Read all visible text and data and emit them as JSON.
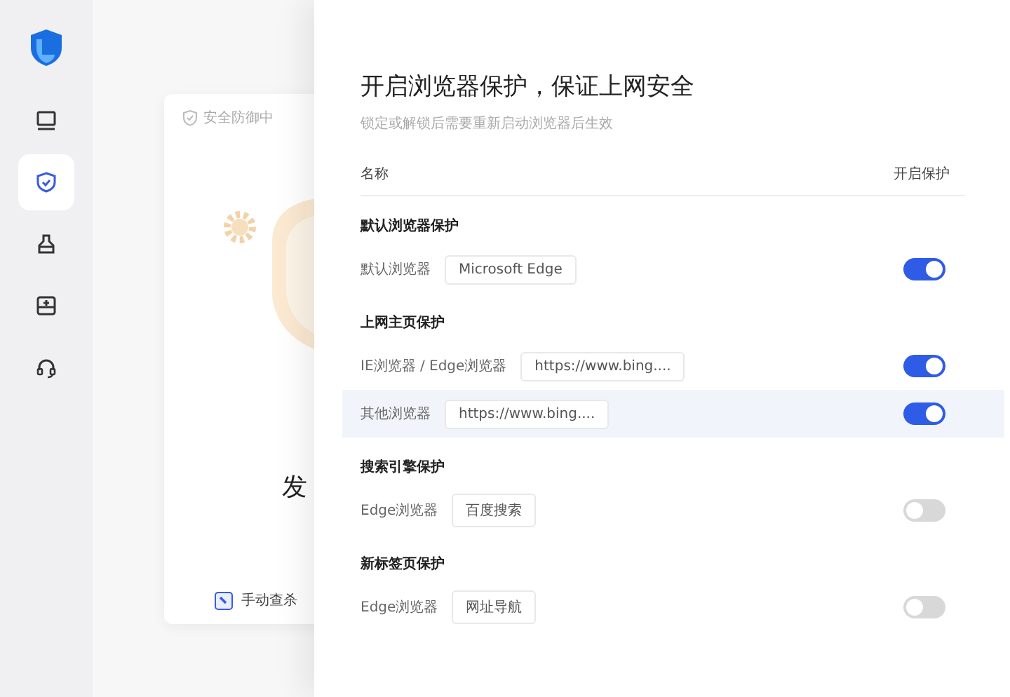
{
  "sidebar": {
    "items": [
      {
        "kind": "monitor",
        "selected": false
      },
      {
        "kind": "shield",
        "selected": true
      },
      {
        "kind": "broom",
        "selected": false
      },
      {
        "kind": "toolbox",
        "selected": false
      },
      {
        "kind": "headset",
        "selected": false
      }
    ]
  },
  "card": {
    "status": "安全防御中",
    "heading": "发",
    "button": "手动查杀"
  },
  "panel": {
    "title": "开启浏览器保护，保证上网安全",
    "subtitle": "锁定或解锁后需要重新启动浏览器后生效",
    "columns": [
      "名称",
      "开启保护"
    ],
    "sections": [
      {
        "heading": "默认浏览器保护",
        "rows": [
          {
            "label": "默认浏览器",
            "value": "Microsoft Edge",
            "on": true,
            "hovered": false
          }
        ]
      },
      {
        "heading": "上网主页保护",
        "rows": [
          {
            "label": "IE浏览器 / Edge浏览器",
            "value": "https://www.bing....",
            "on": true,
            "hovered": false
          },
          {
            "label": "其他浏览器",
            "value": "https://www.bing....",
            "on": true,
            "hovered": true
          }
        ]
      },
      {
        "heading": "搜索引擎保护",
        "rows": [
          {
            "label": "Edge浏览器",
            "value": "百度搜索",
            "on": false,
            "hovered": false
          }
        ]
      },
      {
        "heading": "新标签页保护",
        "rows": [
          {
            "label": "Edge浏览器",
            "value": "网址导航",
            "on": false,
            "hovered": false
          }
        ]
      }
    ]
  }
}
